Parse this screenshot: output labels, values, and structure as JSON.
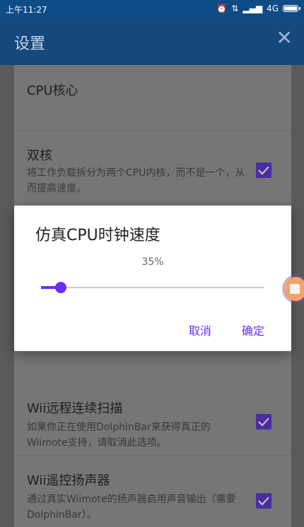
{
  "status_bar": {
    "time": "上午11:27",
    "network": "4G"
  },
  "app_bar": {
    "title": "设置",
    "close_icon": "close-icon"
  },
  "settings": {
    "header": "CPU核心",
    "items": [
      {
        "title": "双核",
        "summary": "将工作负载拆分为两个CPU内核，而不是一个，从而提高速度。",
        "checked": true
      },
      {
        "title": "Wii远程连续扫描",
        "summary": "如果你正在使用DolphinBar来获得真正的Wiimote支持，请取消此选项。",
        "checked": true
      },
      {
        "title": "Wii遥控扬声器",
        "summary": "通过真实Wiimote的扬声器启用声音输出（需要DolphinBar）。",
        "checked": true
      }
    ]
  },
  "dialog": {
    "title": "仿真CPU时钟速度",
    "value_label": "35%",
    "value_fraction": 0.09,
    "cancel_label": "取消",
    "ok_label": "确定"
  },
  "colors": {
    "accent": "#6a2cff",
    "appbar": "#15487b",
    "statusbar": "#0f4b86"
  }
}
